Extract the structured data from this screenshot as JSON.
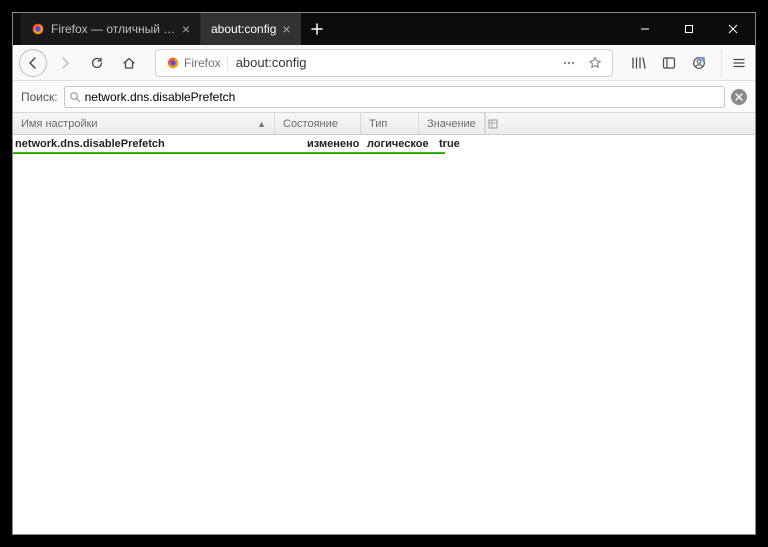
{
  "tabs": [
    {
      "label": "Firefox — отличный браузер д",
      "active": false
    },
    {
      "label": "about:config",
      "active": true
    }
  ],
  "urlbar": {
    "identity_label": "Firefox",
    "url": "about:config"
  },
  "search": {
    "label": "Поиск:",
    "value": "network.dns.disablePrefetch"
  },
  "columns": {
    "pref": "Имя настройки",
    "status": "Состояние",
    "type": "Тип",
    "value": "Значение"
  },
  "rows": [
    {
      "pref": "network.dns.disablePrefetch",
      "status": "изменено",
      "type": "логическое",
      "value": "true"
    }
  ]
}
